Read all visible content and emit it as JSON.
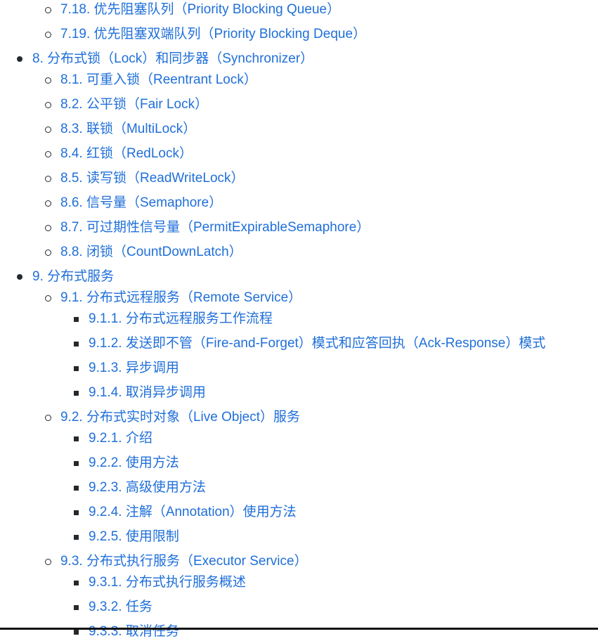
{
  "items": [
    {
      "level": 2,
      "label": "7.18. 优先阻塞队列（Priority Blocking Queue）"
    },
    {
      "level": 2,
      "label": "7.19. 优先阻塞双端队列（Priority Blocking Deque）"
    },
    {
      "level": 1,
      "label": "8. 分布式锁（Lock）和同步器（Synchronizer）"
    },
    {
      "level": 2,
      "label": "8.1. 可重入锁（Reentrant Lock）"
    },
    {
      "level": 2,
      "label": "8.2. 公平锁（Fair Lock）"
    },
    {
      "level": 2,
      "label": "8.3. 联锁（MultiLock）"
    },
    {
      "level": 2,
      "label": "8.4. 红锁（RedLock）"
    },
    {
      "level": 2,
      "label": "8.5. 读写锁（ReadWriteLock）"
    },
    {
      "level": 2,
      "label": "8.6. 信号量（Semaphore）"
    },
    {
      "level": 2,
      "label": "8.7. 可过期性信号量（PermitExpirableSemaphore）"
    },
    {
      "level": 2,
      "label": "8.8. 闭锁（CountDownLatch）"
    },
    {
      "level": 1,
      "label": "9. 分布式服务"
    },
    {
      "level": 2,
      "label": "9.1. 分布式远程服务（Remote Service）"
    },
    {
      "level": 3,
      "label": "9.1.1. 分布式远程服务工作流程"
    },
    {
      "level": 3,
      "label": "9.1.2. 发送即不管（Fire-and-Forget）模式和应答回执（Ack-Response）模式"
    },
    {
      "level": 3,
      "label": "9.1.3. 异步调用"
    },
    {
      "level": 3,
      "label": "9.1.4. 取消异步调用"
    },
    {
      "level": 2,
      "label": "9.2. 分布式实时对象（Live Object）服务"
    },
    {
      "level": 3,
      "label": "9.2.1. 介绍"
    },
    {
      "level": 3,
      "label": "9.2.2. 使用方法"
    },
    {
      "level": 3,
      "label": "9.2.3. 高级使用方法"
    },
    {
      "level": 3,
      "label": "9.2.4. 注解（Annotation）使用方法"
    },
    {
      "level": 3,
      "label": "9.2.5. 使用限制"
    },
    {
      "level": 2,
      "label": "9.3. 分布式执行服务（Executor Service）"
    },
    {
      "level": 3,
      "label": "9.3.1. 分布式执行服务概述"
    },
    {
      "level": 3,
      "label": "9.3.2. 任务"
    },
    {
      "level": 3,
      "label": "9.3.3. 取消任务"
    }
  ]
}
